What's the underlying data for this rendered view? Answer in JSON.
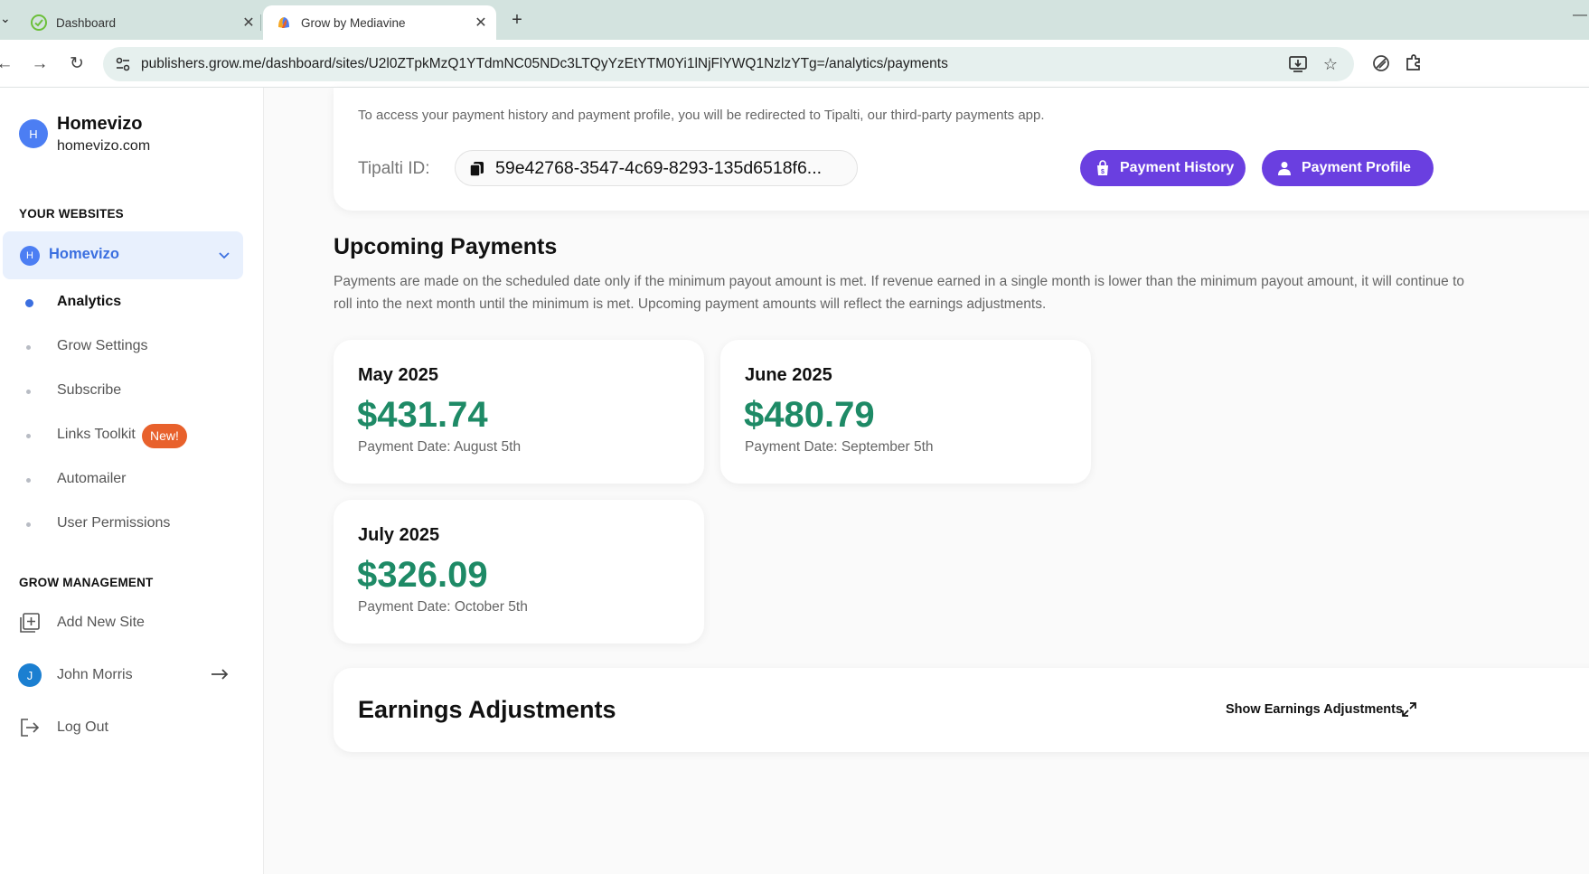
{
  "browser": {
    "tabs": [
      {
        "title": "Dashboard",
        "active": false,
        "favicon": "dashboard-check-icon"
      },
      {
        "title": "Grow by Mediavine",
        "active": true,
        "favicon": "grow-logo-icon"
      }
    ],
    "url": "publishers.grow.me/dashboard/sites/U2l0ZTpkMzQ1YTdmNC05NDc3LTQyYzEtYTM0Yi1lNjFlYWQ1NzlzYTg=/analytics/payments",
    "icons": [
      "back-icon",
      "forward-icon",
      "reload-icon",
      "site-info-icon",
      "install-app-icon",
      "bookmark-star-icon",
      "extension-icon",
      "puzzle-icon"
    ]
  },
  "sidebar": {
    "site_avatar": "H",
    "site_name": "Homevizo",
    "site_domain": "homevizo.com",
    "your_websites_label": "YOUR WEBSITES",
    "selected_site": {
      "avatar": "H",
      "name": "Homevizo"
    },
    "nav": [
      {
        "label": "Analytics",
        "active": true
      },
      {
        "label": "Grow Settings",
        "active": false
      },
      {
        "label": "Subscribe",
        "active": false
      },
      {
        "label": "Links Toolkit",
        "active": false,
        "badge": "New!"
      },
      {
        "label": "Automailer",
        "active": false
      },
      {
        "label": "User Permissions",
        "active": false
      }
    ],
    "management_label": "GROW MANAGEMENT",
    "add_site_label": "Add New Site",
    "user": {
      "avatar": "J",
      "name": "John Morris"
    },
    "logout_label": "Log Out"
  },
  "payments": {
    "redirect_text": "To access your payment history and payment profile, you will be redirected to Tipalti, our third-party payments app.",
    "tipalti_label": "Tipalti ID:",
    "tipalti_id": "59e42768-3547-4c69-8293-135d6518f6...",
    "payment_history_label": "Payment History",
    "payment_profile_label": "Payment Profile",
    "accent_color": "#6a3fe0"
  },
  "upcoming": {
    "heading": "Upcoming Payments",
    "description_line1": "Payments are made on the scheduled date only if the minimum payout amount is met. If revenue earned in a single month is lower than the minimum payout amount, it will continue to",
    "description_line2": "roll into the next month until the minimum is met. Upcoming payment amounts will reflect the earnings adjustments.",
    "amount_color": "#1e8a66",
    "cards": [
      {
        "month": "May 2025",
        "amount": "$431.74",
        "date": "Payment Date: August 5th"
      },
      {
        "month": "June 2025",
        "amount": "$480.79",
        "date": "Payment Date: September 5th"
      },
      {
        "month": "July 2025",
        "amount": "$326.09",
        "date": "Payment Date: October 5th"
      }
    ]
  },
  "earnings": {
    "title": "Earnings Adjustments",
    "toggle_label": "Show Earnings Adjustments"
  }
}
